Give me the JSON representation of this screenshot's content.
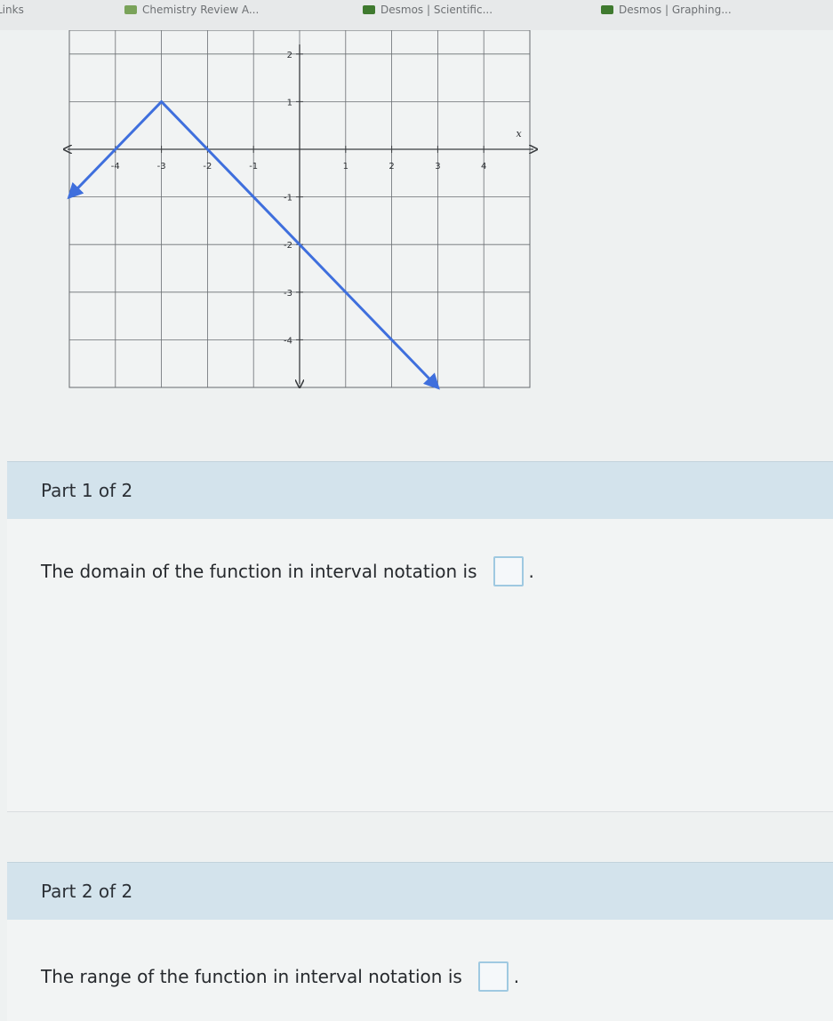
{
  "browser": {
    "bookmarks": [
      {
        "label": "Links",
        "icon": "bookmark-icon",
        "color": "#8a8d90"
      },
      {
        "label": "Chemistry Review A...",
        "icon": "bookmark-icon",
        "color": "#7aa35a"
      },
      {
        "label": "Desmos | Scientific...",
        "icon": "desmos-icon",
        "color": "#3f7a2f"
      },
      {
        "label": "Desmos | Graphing...",
        "icon": "desmos-icon",
        "color": "#3f7a2f"
      }
    ]
  },
  "chart_data": {
    "type": "line",
    "x_tick_labels": [
      "-4",
      "-3",
      "-2",
      "-1",
      "1",
      "2",
      "3",
      "4"
    ],
    "y_tick_labels": [
      "2",
      "1",
      "-1",
      "-2",
      "-3",
      "-4"
    ],
    "x_axis_name": "x",
    "xlim": [
      -5,
      5
    ],
    "ylim": [
      -5,
      2.5
    ],
    "grid": true,
    "line_color": "#3f6fdd",
    "series": [
      {
        "points": [
          [
            -5,
            -1
          ],
          [
            -3,
            1
          ],
          [
            3,
            -5
          ]
        ],
        "arrow_start": true,
        "arrow_end": true
      }
    ]
  },
  "parts": [
    {
      "header": "Part 1 of 2",
      "question": "The domain of the function in interval notation is",
      "period": "."
    },
    {
      "header": "Part 2 of 2",
      "question": "The range of the function in interval notation is",
      "period": "."
    }
  ],
  "colors": {
    "header_bg": "#d3e3ec",
    "answer_border": "#9fc9e1"
  }
}
